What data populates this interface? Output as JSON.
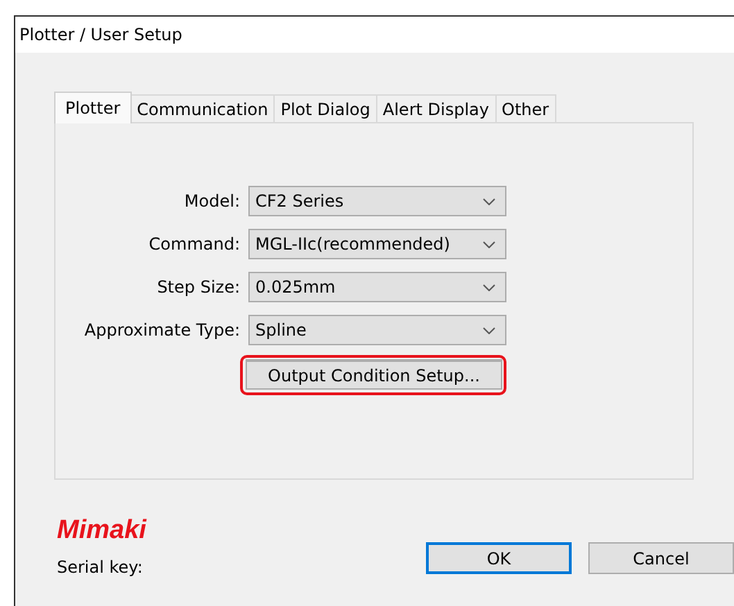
{
  "window": {
    "title": "Plotter / User Setup"
  },
  "tabs": [
    {
      "label": "Plotter",
      "selected": true
    },
    {
      "label": "Communication",
      "selected": false
    },
    {
      "label": "Plot Dialog",
      "selected": false
    },
    {
      "label": "Alert Display",
      "selected": false
    },
    {
      "label": "Other",
      "selected": false
    }
  ],
  "fields": [
    {
      "label": "Model:",
      "value": "CF2 Series"
    },
    {
      "label": "Command:",
      "value": "MGL-IIc(recommended)"
    },
    {
      "label": "Step Size:",
      "value": "0.025mm"
    },
    {
      "label": "Approximate Type:",
      "value": "Spline"
    }
  ],
  "setup_button": {
    "label": "Output Condition Setup...",
    "highlighted": true
  },
  "logo": "Mimaki",
  "serial_key_label": "Serial key:",
  "buttons": [
    {
      "label": "OK",
      "default": true
    },
    {
      "label": "Cancel",
      "default": false
    }
  ]
}
